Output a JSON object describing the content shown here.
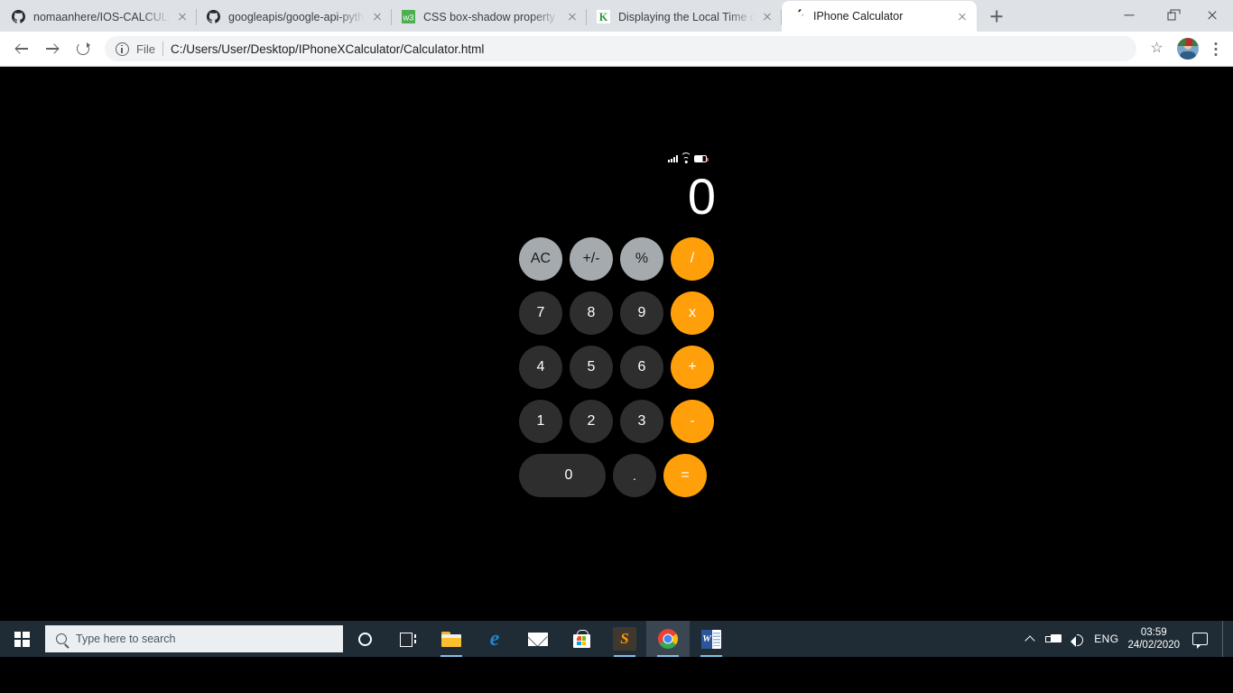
{
  "browser": {
    "tabs": [
      {
        "title": "nomaanhere/IOS-CALCULATOR",
        "favicon": "github-icon",
        "active": false
      },
      {
        "title": "googleapis/google-api-python-",
        "favicon": "github-icon",
        "active": false
      },
      {
        "title": "CSS box-shadow property",
        "favicon": "w3schools-icon",
        "active": false
      },
      {
        "title": "Displaying the Local Time of A",
        "favicon": "k-icon",
        "active": false
      },
      {
        "title": "IPhone Calculator",
        "favicon": "apple-icon",
        "active": true
      }
    ],
    "new_tab_label": "+",
    "window_controls": {
      "minimize": "minimize-icon",
      "maximize": "restore-icon",
      "close": "close-icon"
    },
    "toolbar": {
      "back": "back-arrow-icon",
      "forward": "forward-arrow-icon",
      "reload": "reload-icon",
      "security_label": "File",
      "url": "C:/Users/User/Desktop/IPhoneXCalculator/Calculator.html",
      "bookmark": "star-icon",
      "profile": "avatar",
      "menu": "kebab-menu-icon"
    }
  },
  "calculator": {
    "status_bar": {
      "signal": "signal-bars-icon",
      "wifi": "wifi-icon",
      "battery": "battery-icon"
    },
    "display_value": "0",
    "keys": [
      [
        {
          "label": "AC",
          "style": "gray",
          "name": "key-all-clear"
        },
        {
          "label": "+/-",
          "style": "gray",
          "name": "key-sign-toggle"
        },
        {
          "label": "%",
          "style": "gray",
          "name": "key-percent"
        },
        {
          "label": "/",
          "style": "orange",
          "name": "key-divide"
        }
      ],
      [
        {
          "label": "7",
          "style": "dark",
          "name": "key-7"
        },
        {
          "label": "8",
          "style": "dark",
          "name": "key-8"
        },
        {
          "label": "9",
          "style": "dark",
          "name": "key-9"
        },
        {
          "label": "x",
          "style": "orange",
          "name": "key-multiply"
        }
      ],
      [
        {
          "label": "4",
          "style": "dark",
          "name": "key-4"
        },
        {
          "label": "5",
          "style": "dark",
          "name": "key-5"
        },
        {
          "label": "6",
          "style": "dark",
          "name": "key-6"
        },
        {
          "label": "+",
          "style": "orange",
          "name": "key-add"
        }
      ],
      [
        {
          "label": "1",
          "style": "dark",
          "name": "key-1"
        },
        {
          "label": "2",
          "style": "dark",
          "name": "key-2"
        },
        {
          "label": "3",
          "style": "dark",
          "name": "key-3"
        },
        {
          "label": "-",
          "style": "orange",
          "name": "key-subtract"
        }
      ],
      [
        {
          "label": "0",
          "style": "dark wide",
          "name": "key-0"
        },
        {
          "label": ".",
          "style": "dark dot",
          "name": "key-decimal"
        },
        {
          "label": "=",
          "style": "orange",
          "name": "key-equals"
        }
      ]
    ],
    "colors": {
      "background": "#000000",
      "dark_key": "#2e2e2e",
      "gray_key": "#a5aaae",
      "orange_key": "#ff9f0a",
      "display_text": "#ffffff"
    }
  },
  "taskbar": {
    "start": "windows-logo-icon",
    "search_placeholder": "Type here to search",
    "cortana": "cortana-icon",
    "task_view": "task-view-icon",
    "apps": [
      {
        "name": "file-explorer-icon",
        "running": true
      },
      {
        "name": "edge-icon",
        "running": false
      },
      {
        "name": "mail-icon",
        "running": false
      },
      {
        "name": "microsoft-store-icon",
        "running": false
      },
      {
        "name": "sublime-text-icon",
        "running": true
      },
      {
        "name": "chrome-icon",
        "running": true,
        "active": true
      },
      {
        "name": "word-icon",
        "running": true
      }
    ],
    "tray": {
      "overflow": "chevron-up-icon",
      "power": "battery-plug-icon",
      "volume": "volume-icon",
      "language": "ENG",
      "time": "03:59",
      "date": "24/02/2020",
      "action_center": "notifications-icon"
    }
  }
}
